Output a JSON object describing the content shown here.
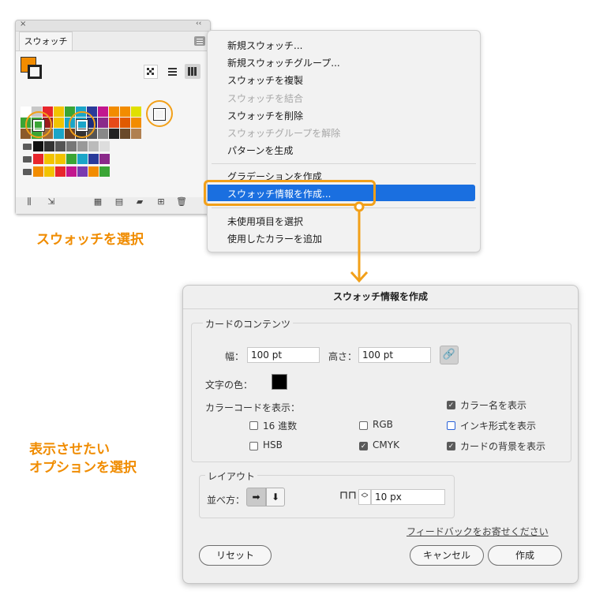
{
  "colors": {
    "accent": "#f2a019",
    "selection": "#1a6fe0",
    "annotation_text": "#f08c00"
  },
  "panel": {
    "close_glyph": "×",
    "collapse_glyph": "‹‹",
    "tab_label": "スウォッチ"
  },
  "menu": {
    "items": [
      "新規スウォッチ...",
      "新規スウォッチグループ...",
      "スウォッチを複製",
      "スウォッチを結合",
      "スウォッチを削除",
      "スウォッチグループを解除",
      "パターンを生成",
      "グラデーションを作成",
      "スウォッチ情報を作成...",
      "未使用項目を選択",
      "使用したカラーを追加"
    ]
  },
  "annotations": {
    "select_swatches": "スウォッチを選択",
    "select_options_line1": "表示させたい",
    "select_options_line2": "オプションを選択"
  },
  "dialog": {
    "title": "スウォッチ情報を作成",
    "card_group_label": "カードのコンテンツ",
    "width_label": "幅：",
    "width_value": "100 pt",
    "height_label": "高さ：",
    "height_value": "100 pt",
    "text_color_label": "文字の色：",
    "colorcode_label": "カラーコードを表示：",
    "opt_hex": "16 進数",
    "opt_hsb": "HSB",
    "opt_rgb": "RGB",
    "opt_cmyk": "CMYK",
    "opt_color_name": "カラー名を表示",
    "opt_inks": "インキ形式を表示",
    "opt_card_bg": "カードの背景を表示",
    "layout_group_label": "レイアウト",
    "arrange_label": "並べ方：",
    "spacing_value": "10 px",
    "feedback_link": "フィードバックをお寄せください",
    "reset_button": "リセット",
    "cancel_button": "キャンセル",
    "create_button": "作成"
  }
}
